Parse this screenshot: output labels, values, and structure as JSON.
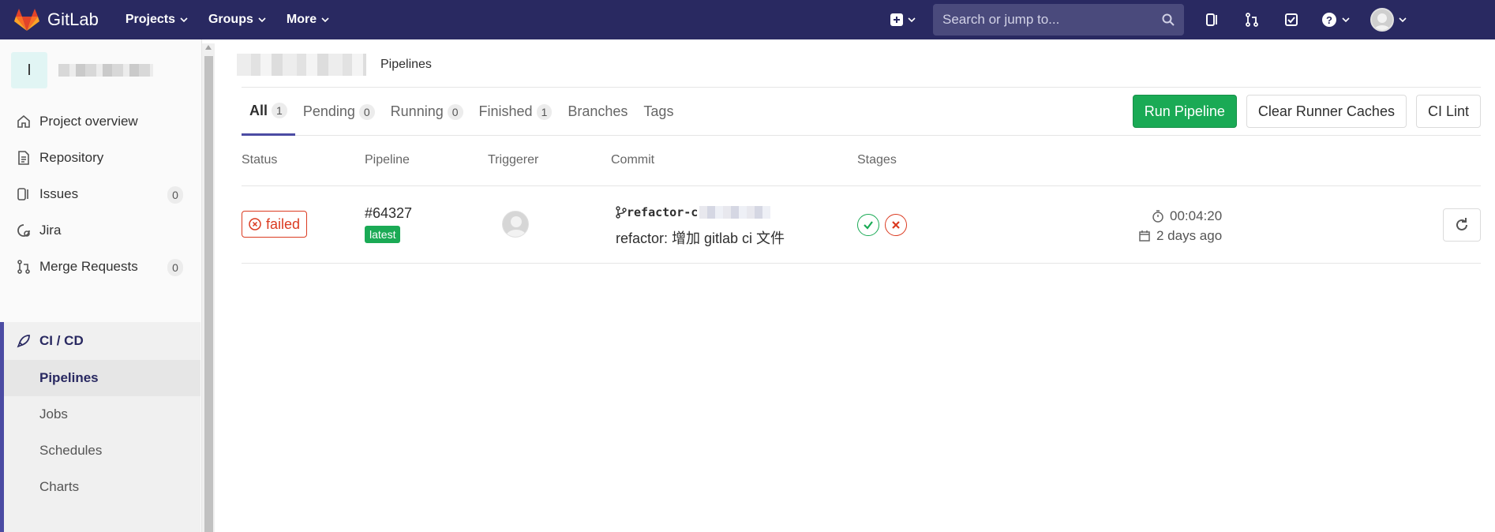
{
  "brand": {
    "name": "GitLab"
  },
  "nav": {
    "menu": [
      "Projects",
      "Groups",
      "More"
    ],
    "search_placeholder": "Search or jump to..."
  },
  "sidebar": {
    "project_initial": "I",
    "items": [
      {
        "label": "Project overview",
        "icon": "home-icon"
      },
      {
        "label": "Repository",
        "icon": "doc-icon"
      },
      {
        "label": "Issues",
        "icon": "issues-icon",
        "count": "0"
      },
      {
        "label": "Jira",
        "icon": "jira-icon"
      },
      {
        "label": "Merge Requests",
        "icon": "merge-request-icon",
        "count": "0"
      }
    ],
    "active_section": "CI / CD",
    "sub_items": [
      "Pipelines",
      "Jobs",
      "Schedules",
      "Charts"
    ]
  },
  "breadcrumb": {
    "current": "Pipelines"
  },
  "tabs": [
    {
      "label": "All",
      "count": "1"
    },
    {
      "label": "Pending",
      "count": "0"
    },
    {
      "label": "Running",
      "count": "0"
    },
    {
      "label": "Finished",
      "count": "1"
    },
    {
      "label": "Branches"
    },
    {
      "label": "Tags"
    }
  ],
  "actions": {
    "run": "Run Pipeline",
    "clear": "Clear Runner Caches",
    "lint": "CI Lint"
  },
  "table": {
    "headers": [
      "Status",
      "Pipeline",
      "Triggerer",
      "Commit",
      "Stages"
    ],
    "rows": [
      {
        "status": "failed",
        "pipeline_id": "#64327",
        "tag": "latest",
        "ref": "refactor-c",
        "commit_message": "refactor: 增加 gitlab ci 文件",
        "duration": "00:04:20",
        "finished": "2 days ago"
      }
    ]
  },
  "colors": {
    "navbar": "#292961",
    "success": "#1aaa55",
    "failed": "#db3b21",
    "accent": "#4b4ba3"
  }
}
